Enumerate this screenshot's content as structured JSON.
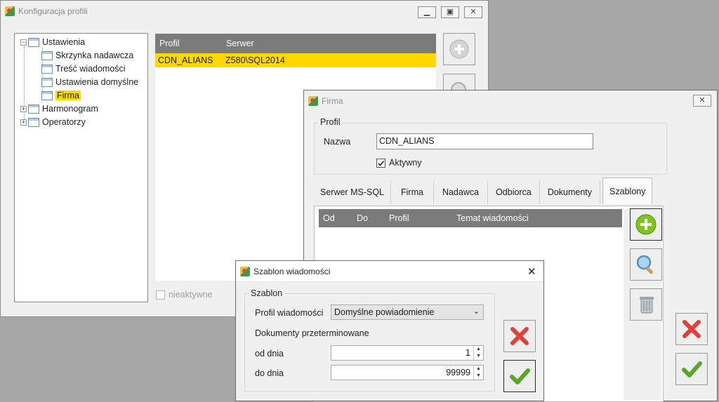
{
  "main_window": {
    "title": "Konfiguracja profili",
    "tree": {
      "root": "Ustawienia",
      "children": [
        "Skrzynka nadawcza",
        "Treść wiadomości",
        "Ustawienia domyślne",
        "Firma"
      ],
      "siblings": [
        "Harmonogram",
        "Operatorzy"
      ]
    },
    "grid": {
      "columns": [
        "Profil",
        "Serwer"
      ],
      "rows": [
        {
          "profil": "CDN_ALIANS",
          "serwer": "Z580\\SQL2014"
        }
      ]
    },
    "inactive_label": "nieaktywne"
  },
  "firma_window": {
    "title": "Firma",
    "group_label": "Profil",
    "name_label": "Nazwa",
    "name_value": "CDN_ALIANS",
    "active_label": "Aktywny",
    "tabs": [
      "Serwer MS-SQL",
      "Firma",
      "Nadawca",
      "Odbiorca",
      "Dokumenty",
      "Szablony"
    ],
    "active_tab": "Szablony",
    "table_columns": [
      "Od",
      "Do",
      "Profil",
      "Temat wiadomości"
    ]
  },
  "szablon_window": {
    "title": "Szablon wiadomości",
    "group_label": "Szablon",
    "profile_label": "Profil wiadomości",
    "profile_value": "Domyślne powiadomienie",
    "overdue_label": "Dokumenty przeterminowane",
    "from_label": "od dnia",
    "from_value": "1",
    "to_label": "do dnia",
    "to_value": "99999"
  },
  "colors": {
    "selection": "#ffd800",
    "header_gray": "#7b7b7b",
    "add_green": "#7fc41c",
    "cancel_red": "#e0403a",
    "ok_green": "#5aa52a"
  },
  "icons": [
    "add-icon",
    "search-icon",
    "delete-icon",
    "cancel-icon",
    "ok-icon",
    "close-icon",
    "minimize-icon",
    "maximize-icon",
    "chevron-down-icon"
  ]
}
